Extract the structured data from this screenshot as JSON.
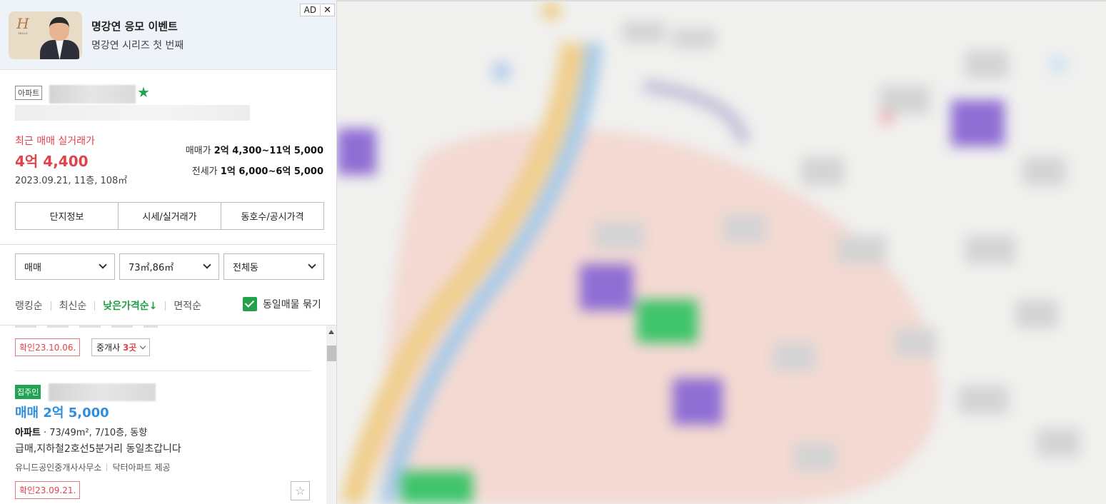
{
  "ad": {
    "title": "명강연 응모 이벤트",
    "subtitle": "명강연 시리즈 첫 번째",
    "tag": "AD",
    "close": "✕"
  },
  "complex": {
    "type_badge": "아파트",
    "recent_label": "최근 매매 실거래가",
    "recent_price": "4억 4,400",
    "recent_meta": "2023.09.21, 11층, 108㎡",
    "sale_range_label": "매매가",
    "sale_range": "2억 4,300~11억 5,000",
    "jeonse_range_label": "전세가",
    "jeonse_range": "1억 6,000~6억 5,000",
    "tabs": [
      "단지정보",
      "시세/실거래가",
      "동호수/공시가격"
    ]
  },
  "filters": {
    "deal_type": "매매",
    "area": "73㎡,86㎡",
    "dong": "전체동"
  },
  "sort": {
    "options": [
      "랭킹순",
      "최신순",
      "낮은가격순↓",
      "면적순"
    ],
    "active_index": 2,
    "same_group_label": "동일매물 묶기",
    "same_group_checked": true
  },
  "listings": {
    "first": {
      "confirm": "확인23.10.06.",
      "broker_prefix": "중개사",
      "broker_count": "3곳"
    },
    "second": {
      "badge": "집주인",
      "price": "매매 2억 5,000",
      "spec_type": "아파트",
      "spec_detail": " · 73/49m², 7/10층, 동향",
      "desc": "급매,지하철2호선5분거리 동일초갑니다",
      "agency": "유니드공인중개사사무소",
      "provider": "닥터아파트 제공",
      "confirm": "확인23.09.21."
    }
  },
  "colors": {
    "accent_green": "#21a452",
    "price_red": "#e0434b",
    "price_blue": "#2f8fde"
  }
}
